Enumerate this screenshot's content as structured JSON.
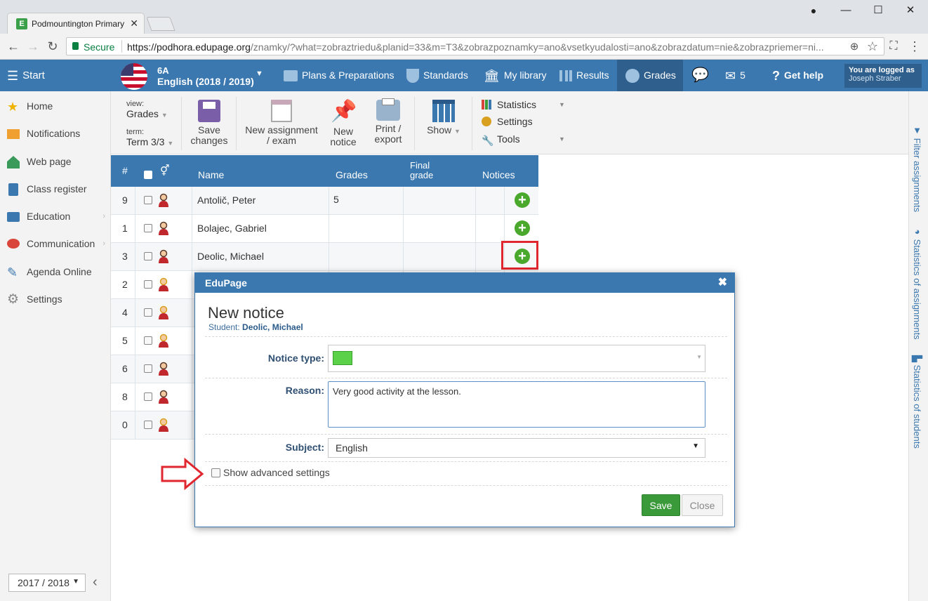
{
  "browser": {
    "tab_title": "Podmountington Primary",
    "url_secure": "Secure",
    "url_host": "https://podhora.edupage.org",
    "url_path": "/znamky/?what=zobraztriedu&planid=33&m=T3&zobrazpoznamky=ano&vsetkyudalosti=ano&zobrazdatum=nie&zobrazpriemer=ni..."
  },
  "header": {
    "start": "Start",
    "class_name": "6A",
    "subject_year": "English (2018 / 2019)",
    "nav": [
      "Plans & Preparations",
      "Standards",
      "My library",
      "Results",
      "Grades"
    ],
    "messages_count": "5",
    "help": "Get help",
    "logged_label": "You are logged as",
    "user": "Joseph Straber"
  },
  "sidebar": {
    "items": [
      {
        "label": "Home"
      },
      {
        "label": "Notifications"
      },
      {
        "label": "Web page"
      },
      {
        "label": "Class register"
      },
      {
        "label": "Education"
      },
      {
        "label": "Communication"
      },
      {
        "label": "Agenda Online"
      },
      {
        "label": "Settings"
      }
    ],
    "year": "2017 / 2018"
  },
  "ribbon": {
    "view_label": "view:",
    "view_value": "Grades",
    "term_label": "term:",
    "term_value": "Term 3/3",
    "save_l1": "Save",
    "save_l2": "changes",
    "newassign_l1": "New assignment",
    "newassign_l2": "/ exam",
    "newnotice_l1": "New",
    "newnotice_l2": "notice",
    "print_l1": "Print /",
    "print_l2": "export",
    "show": "Show",
    "menu": [
      "Statistics",
      "Settings",
      "Tools"
    ]
  },
  "right_panel": [
    "Filter assignments",
    "Statistics of assignments",
    "Statistics of students"
  ],
  "table": {
    "headers": {
      "num": "#",
      "name": "Name",
      "grades": "Grades",
      "final_l1": "Final",
      "final_l2": "grade",
      "notices": "Notices"
    },
    "rows": [
      {
        "num": "9",
        "name": "Antolič, Peter",
        "grades": "5"
      },
      {
        "num": "1",
        "name": "Bolajec, Gabriel",
        "grades": ""
      },
      {
        "num": "3",
        "name": "Deolic, Michael",
        "grades": ""
      },
      {
        "num": "2",
        "name": "",
        "grades": ""
      },
      {
        "num": "4",
        "name": "",
        "grades": ""
      },
      {
        "num": "5",
        "name": "",
        "grades": ""
      },
      {
        "num": "6",
        "name": "",
        "grades": ""
      },
      {
        "num": "8",
        "name": "",
        "grades": ""
      },
      {
        "num": "0",
        "name": "",
        "grades": ""
      }
    ]
  },
  "dialog": {
    "title": "EduPage",
    "heading": "New notice",
    "student_label": "Student:",
    "student_name": "Deolic, Michael",
    "notice_type_label": "Notice type:",
    "reason_label": "Reason:",
    "reason_value": "Very good activity at the lesson.",
    "subject_label": "Subject:",
    "subject_value": "English",
    "advanced": "Show advanced settings",
    "save": "Save",
    "close": "Close"
  },
  "colors": {
    "header_blue": "#3b78b0",
    "add_green": "#4aa82c",
    "highlight_red": "#e0262e",
    "save_green": "#3a9a3a"
  }
}
